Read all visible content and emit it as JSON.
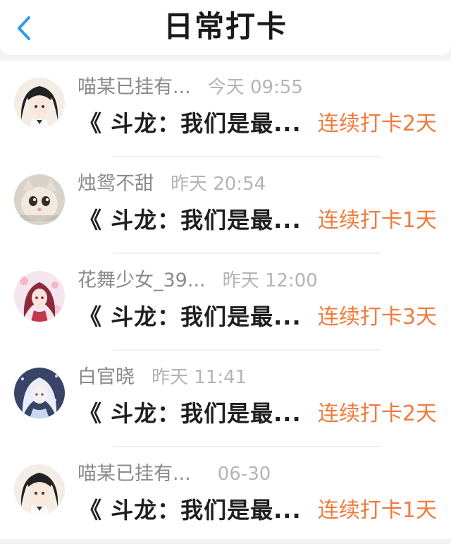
{
  "header": {
    "title": "日常打卡"
  },
  "entries": [
    {
      "nickname": "喵某已挂有...",
      "time": "今天 09:55",
      "title": "《 斗龙：我们是最...",
      "streak": "连续打卡2天",
      "avatar": "dark-hair-girl-avatar"
    },
    {
      "nickname": "烛鸳不甜",
      "time": "昨天 20:54",
      "title": "《 斗龙：我们是最...",
      "streak": "连续打卡1天",
      "avatar": "cat-avatar"
    },
    {
      "nickname": "花舞少女_39...",
      "time": "昨天 12:00",
      "title": "《 斗龙：我们是最...",
      "streak": "连续打卡3天",
      "avatar": "red-hair-girl-avatar"
    },
    {
      "nickname": "白官晓",
      "time": "昨天 11:41",
      "title": "《 斗龙：我们是最...",
      "streak": "连续打卡2天",
      "avatar": "white-hair-girl-avatar"
    },
    {
      "nickname": "喵某已挂有...",
      "time": "06-30",
      "title": "《 斗龙：我们是最...",
      "streak": "连续打卡1天",
      "avatar": "dark-hair-girl-avatar"
    }
  ],
  "colors": {
    "accent_blue": "#2f9cf0",
    "streak_orange": "#f07b3d"
  }
}
